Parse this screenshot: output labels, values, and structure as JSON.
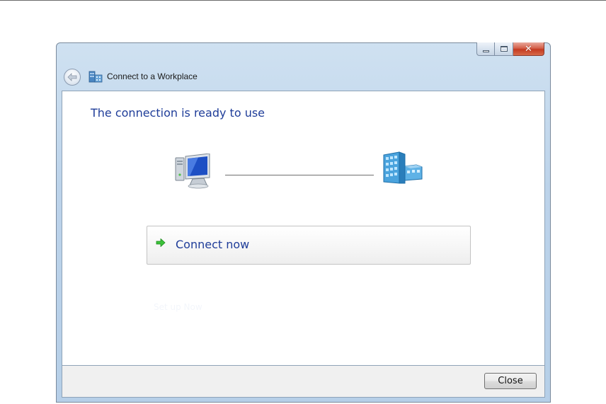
{
  "window": {
    "title": "Connect to a Workplace",
    "controls": {
      "minimize": "minimize-icon",
      "maximize": "maximize-icon",
      "close": "close-icon"
    }
  },
  "main": {
    "heading": "The connection is ready to use",
    "connect_button_label": "Connect now",
    "faint_text": "Set up Now"
  },
  "footer": {
    "close_label": "Close"
  },
  "icons": {
    "back": "back-arrow-icon",
    "app": "workplace-icon",
    "computer": "computer-icon",
    "building": "workplace-building-icon",
    "arrow": "green-arrow-icon"
  },
  "colors": {
    "heading": "#1f3d99",
    "link": "#1f3d99",
    "titlebar": "#bcd3ea"
  }
}
